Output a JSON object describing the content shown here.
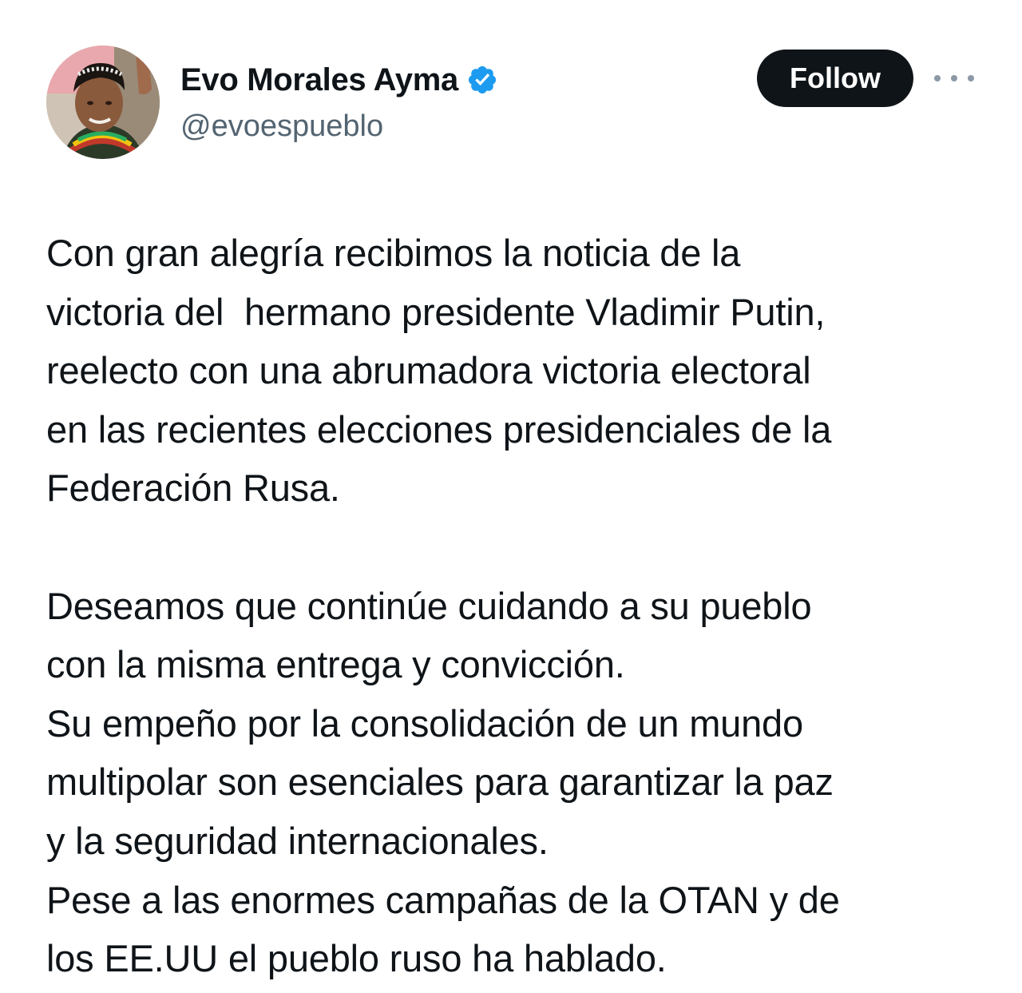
{
  "author": {
    "display_name": "Evo Morales Ayma",
    "handle": "@evoespueblo",
    "verified": true,
    "verified_icon": "verified-badge-icon",
    "verified_color": "#1d9bf0"
  },
  "actions": {
    "follow_label": "Follow",
    "more_icon": "more-horizontal-icon"
  },
  "tweet": {
    "lines": [
      "Con gran alegría recibimos la noticia de la",
      "victoria del  hermano presidente Vladimir Putin,",
      "reelecto con una abrumadora victoria electoral",
      "en las recientes elecciones presidenciales de la",
      "Federación Rusa.",
      "",
      "Deseamos que continúe cuidando a su pueblo",
      "con la misma entrega y convicción.",
      "Su empeño por la consolidación de un mundo",
      "multipolar son esenciales para garantizar la paz",
      "y la seguridad internacionales.",
      "Pese a las enormes campañas de la OTAN y de",
      "los EE.UU el pueblo ruso ha hablado."
    ]
  },
  "colors": {
    "text": "#0f1419",
    "secondary_text": "#536471",
    "follow_button_bg": "#0f1419",
    "follow_button_text": "#ffffff"
  }
}
